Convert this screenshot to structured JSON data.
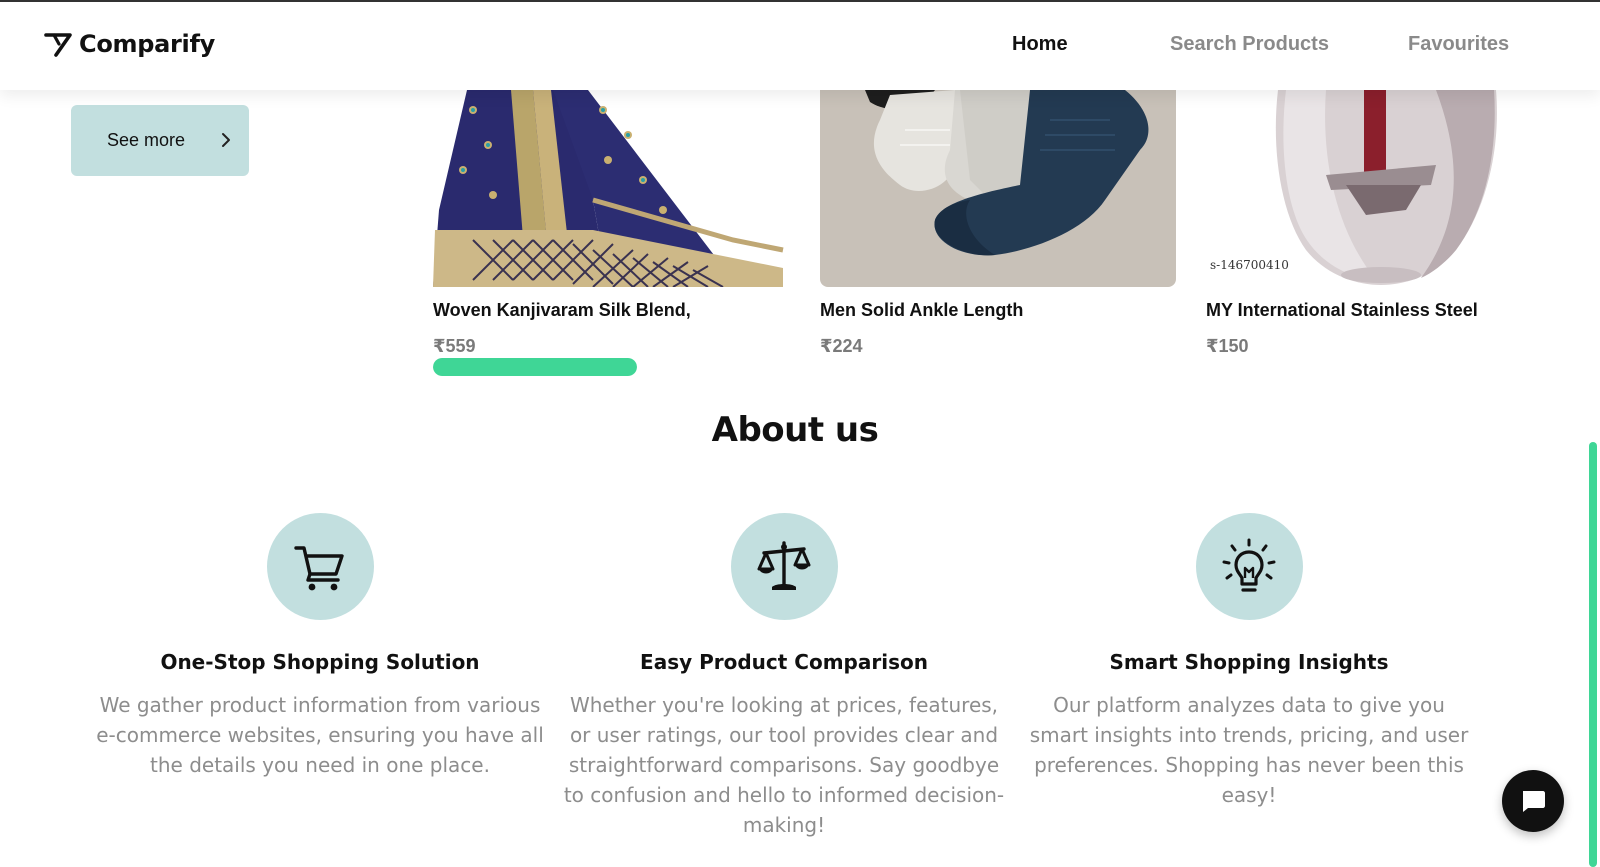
{
  "header": {
    "brand_name": "Comparify",
    "brand_icon": "comparify-logo-icon",
    "nav": [
      {
        "label": "Home",
        "active": true
      },
      {
        "label": "Search Products",
        "active": false
      },
      {
        "label": "Favourites",
        "active": false
      }
    ]
  },
  "carousel": {
    "see_more_label": "See more",
    "progress_fraction": 0.3,
    "products": [
      {
        "title": "Woven Kanjivaram Silk Blend,",
        "price": "₹559",
        "image": "saree-image"
      },
      {
        "title": "Men Solid Ankle Length",
        "price": "₹224",
        "image": "socks-image"
      },
      {
        "title": "MY International Stainless Steel",
        "price": "₹150",
        "image": "chopper-image",
        "image_caption": "s-146700410"
      }
    ]
  },
  "about": {
    "heading": "About us",
    "features": [
      {
        "icon": "shopping-cart-icon",
        "title": "One-Stop Shopping Solution",
        "text": "We gather product information from various e-commerce websites, ensuring you have all the details you need in one place."
      },
      {
        "icon": "balance-scale-icon",
        "title": "Easy Product Comparison",
        "text": "Whether you're looking at prices, features, or user ratings, our tool provides clear and straightforward comparisons. Say goodbye to confusion and hello to informed decision-making!"
      },
      {
        "icon": "lightbulb-icon",
        "title": "Smart Shopping Insights",
        "text": "Our platform analyzes data to give you smart insights into trends, pricing, and user preferences. Shopping has never been this easy!"
      }
    ]
  },
  "chat": {
    "icon": "chat-bubble-icon"
  },
  "colors": {
    "accent_teal": "#c2dfdf",
    "progress_green": "#3fd696",
    "muted_text": "#8d8d8d"
  }
}
